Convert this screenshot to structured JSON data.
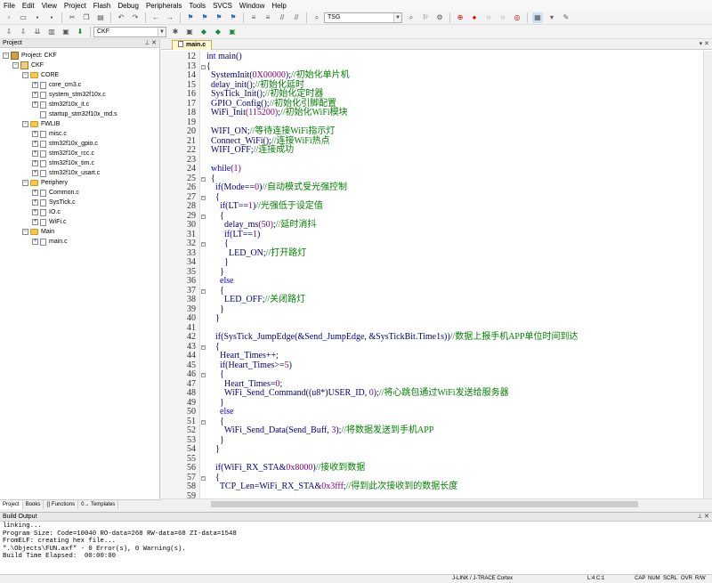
{
  "menu": [
    "File",
    "Edit",
    "View",
    "Project",
    "Flash",
    "Debug",
    "Peripherals",
    "Tools",
    "SVCS",
    "Window",
    "Help"
  ],
  "toolbar": {
    "find_value": "TSG",
    "target_value": "CKF"
  },
  "project_pane": {
    "title": "Project",
    "items": [
      {
        "label": "Project: CKF",
        "level": 0,
        "kind": "project",
        "expander": "−"
      },
      {
        "label": "CKF",
        "level": 1,
        "kind": "target",
        "expander": "−"
      },
      {
        "label": "CORE",
        "level": 2,
        "kind": "folder",
        "expander": "−"
      },
      {
        "label": "core_cm3.c",
        "level": 3,
        "kind": "file",
        "expander": "+"
      },
      {
        "label": "system_stm32f10x.c",
        "level": 3,
        "kind": "file",
        "expander": "+"
      },
      {
        "label": "stm32f10x_it.c",
        "level": 3,
        "kind": "file",
        "expander": "+"
      },
      {
        "label": "startup_stm32f10x_md.s",
        "level": 3,
        "kind": "file",
        "expander": ""
      },
      {
        "label": "FWLIB",
        "level": 2,
        "kind": "folder",
        "expander": "−"
      },
      {
        "label": "misc.c",
        "level": 3,
        "kind": "file",
        "expander": "+"
      },
      {
        "label": "stm32f10x_gpio.c",
        "level": 3,
        "kind": "file",
        "expander": "+"
      },
      {
        "label": "stm32f10x_rcc.c",
        "level": 3,
        "kind": "file",
        "expander": "+"
      },
      {
        "label": "stm32f10x_tim.c",
        "level": 3,
        "kind": "file",
        "expander": "+"
      },
      {
        "label": "stm32f10x_usart.c",
        "level": 3,
        "kind": "file",
        "expander": "+"
      },
      {
        "label": "Periphery",
        "level": 2,
        "kind": "folder",
        "expander": "−"
      },
      {
        "label": "Common.c",
        "level": 3,
        "kind": "file",
        "expander": "+"
      },
      {
        "label": "SysTick.c",
        "level": 3,
        "kind": "file",
        "expander": "+"
      },
      {
        "label": "IO.c",
        "level": 3,
        "kind": "file",
        "expander": "+"
      },
      {
        "label": "WiFi.c",
        "level": 3,
        "kind": "file",
        "expander": "+"
      },
      {
        "label": "Main",
        "level": 2,
        "kind": "folder",
        "expander": "−"
      },
      {
        "label": "main.c",
        "level": 3,
        "kind": "file",
        "expander": "+"
      }
    ],
    "bottom_tabs": [
      "Project",
      "Books",
      "{} Functions",
      "0→ Templates"
    ]
  },
  "editor": {
    "tab_label": "main.c",
    "lines": [
      {
        "n": "12",
        "code": "int main()"
      },
      {
        "n": "13",
        "code": "{"
      },
      {
        "n": "14",
        "code": "  SystemInit(0X00000);",
        "comment": "//初始化单片机"
      },
      {
        "n": "15",
        "code": "  delay_init();",
        "comment": "//初始化延时"
      },
      {
        "n": "16",
        "code": "  SysTick_Init();",
        "comment": "//初始化定时器"
      },
      {
        "n": "17",
        "code": "  GPIO_Config();",
        "comment": "//初始化引脚配置"
      },
      {
        "n": "18",
        "code": "  WiFi_Init(115200);",
        "comment": "//初始化WiFi模块"
      },
      {
        "n": "19",
        "code": ""
      },
      {
        "n": "20",
        "code": "  WIFI_ON;",
        "comment": "//等待连接WiFi指示灯"
      },
      {
        "n": "21",
        "code": "  Connect_WiFi();",
        "comment": "//连接WiFi热点"
      },
      {
        "n": "22",
        "code": "  WIFI_OFF;",
        "comment": "//连接成功"
      },
      {
        "n": "23",
        "code": ""
      },
      {
        "n": "24",
        "code": "  while(1)"
      },
      {
        "n": "25",
        "code": "  {"
      },
      {
        "n": "26",
        "code": "    if(Mode==0)",
        "comment": "//自动模式受光强控制"
      },
      {
        "n": "27",
        "code": "    {"
      },
      {
        "n": "28",
        "code": "      if(LT==1)",
        "comment": "//光强低于设定值"
      },
      {
        "n": "29",
        "code": "      {"
      },
      {
        "n": "30",
        "code": "        delay_ms(50);",
        "comment": "//延时消抖"
      },
      {
        "n": "31",
        "code": "        if(LT==1)"
      },
      {
        "n": "32",
        "code": "        {"
      },
      {
        "n": "33",
        "code": "          LED_ON;",
        "comment": "//打开路灯"
      },
      {
        "n": "34",
        "code": "        }"
      },
      {
        "n": "35",
        "code": "      }"
      },
      {
        "n": "36",
        "code": "      else"
      },
      {
        "n": "37",
        "code": "      {"
      },
      {
        "n": "38",
        "code": "        LED_OFF;",
        "comment": "//关闭路灯"
      },
      {
        "n": "39",
        "code": "      }"
      },
      {
        "n": "40",
        "code": "    }"
      },
      {
        "n": "41",
        "code": ""
      },
      {
        "n": "42",
        "code": "    if(SysTick_JumpEdge(&Send_JumpEdge, &SysTickBit.Time1s))",
        "comment": "//数据上报手机APP单位时间到达"
      },
      {
        "n": "43",
        "code": "    {"
      },
      {
        "n": "44",
        "code": "      Heart_Times++;"
      },
      {
        "n": "45",
        "code": "      if(Heart_Times>=5)"
      },
      {
        "n": "46",
        "code": "      {"
      },
      {
        "n": "47",
        "code": "        Heart_Times=0;"
      },
      {
        "n": "48",
        "code": "        WiFi_Send_Command((u8*)USER_ID, 0);",
        "comment": "//将心跳包通过WiFi发送给服务器"
      },
      {
        "n": "49",
        "code": "      }"
      },
      {
        "n": "50",
        "code": "      else"
      },
      {
        "n": "51",
        "code": "      {"
      },
      {
        "n": "52",
        "code": "        WiFi_Send_Data(Send_Buff, 3);",
        "comment": "//将数据发送到手机APP"
      },
      {
        "n": "53",
        "code": "      }"
      },
      {
        "n": "54",
        "code": "    }"
      },
      {
        "n": "55",
        "code": ""
      },
      {
        "n": "56",
        "code": "    if(WiFi_RX_STA&0x8000)",
        "comment": "//接收到数据"
      },
      {
        "n": "57",
        "code": "    {"
      },
      {
        "n": "58",
        "code": "      TCP_Len=WiFi_RX_STA&0x3fff;",
        "comment": "//得到此次接收到的数据长度"
      },
      {
        "n": "59",
        "code": ""
      }
    ]
  },
  "build_output": {
    "title": "Build Output",
    "lines": [
      "linking...",
      "Program Size: Code=10040 RO-data=268 RW-data=68 ZI-data=1548",
      "FromELF: creating hex file...",
      "\".\\Objects\\FUN.axf\" - 0 Error(s), 0 Warning(s).",
      "Build Time Elapsed:  00:00:00"
    ]
  },
  "status": {
    "debugger": "J-LINK / J-TRACE Cortex",
    "position": "L:4 C:1",
    "caps": "CAP",
    "num": "NUM",
    "scrl": "SCRL",
    "ovr": "OVR",
    "rw": "R/W"
  },
  "colors": {
    "comment": "#008000",
    "keyword": "#0000ff",
    "code": "#000080",
    "folder": "#f5c84c"
  }
}
